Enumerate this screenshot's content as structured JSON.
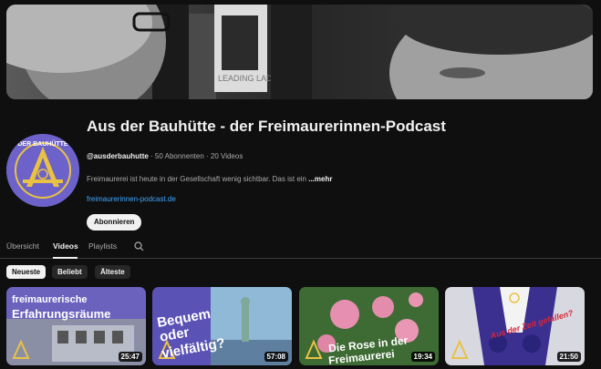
{
  "channel": {
    "name": "Aus der Bauhütte - der Freimaurerinnen-Podcast",
    "handle": "@ausderbauhutte",
    "stats": "· 50 Abonnenten · 20 Videos",
    "description": "Freimaurerei ist heute in der Gesellschaft wenig sichtbar. Das ist ein",
    "more_label": "...mehr",
    "link": "freimaurerinnen-podcast.de",
    "subscribe_label": "Abonnieren",
    "banner_book_text": "LEADING LADIES",
    "avatar_text": "DER BAUHÜTTE"
  },
  "tabs": [
    {
      "label": "Übersicht",
      "active": false
    },
    {
      "label": "Videos",
      "active": true
    },
    {
      "label": "Playlists",
      "active": false
    }
  ],
  "filters": [
    {
      "label": "Neueste",
      "active": true
    },
    {
      "label": "Beliebt",
      "active": false
    },
    {
      "label": "Älteste",
      "active": false
    }
  ],
  "videos": [
    {
      "overlay_line1": "freimaurerische",
      "overlay_line2": "Erfahrungsräume",
      "duration": "25:47"
    },
    {
      "overlay_line1": "Bequem",
      "overlay_line2": "oder",
      "overlay_line3": "vielfältig?",
      "duration": "57:08"
    },
    {
      "overlay_line1": "Die Rose in der",
      "overlay_line2": "Freimaurerei",
      "duration": "19:34"
    },
    {
      "overlay_line1": "Aus der Zeit gefallen?",
      "duration": "21:50"
    }
  ],
  "icons": {
    "search": "search-icon"
  }
}
